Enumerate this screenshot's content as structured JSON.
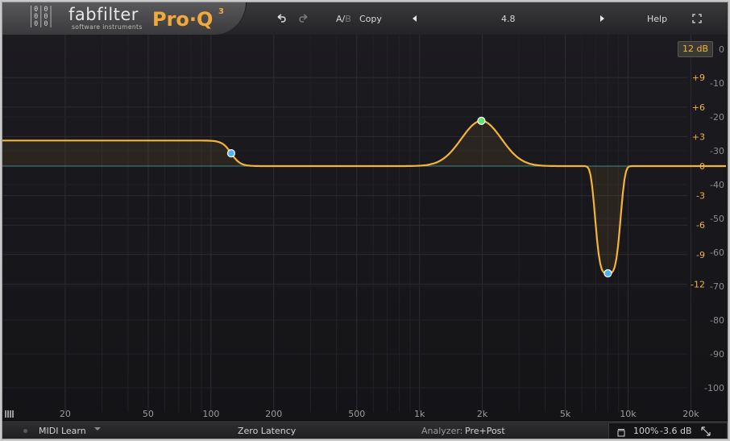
{
  "header": {
    "logo_mark": "|0|0|\n|0|0|\n|0|0|",
    "brand": "fabfilter",
    "brand_sub": "software instruments",
    "product": "Pro·Q",
    "product_sup": "3",
    "undo_icon": "undo-icon",
    "redo_icon": "redo-icon",
    "ab_label_a": "A/",
    "ab_label_b": "B",
    "copy_label": "Copy",
    "preset_value": "4.8",
    "help_label": "Help",
    "fullscreen_icon": "fullscreen-icon"
  },
  "display": {
    "range_badge": "12 dB",
    "gain_ticks": [
      {
        "label": "+9",
        "db": 9
      },
      {
        "label": "+6",
        "db": 6
      },
      {
        "label": "+3",
        "db": 3
      },
      {
        "label": "0",
        "db": 0
      },
      {
        "label": "-3",
        "db": -3
      },
      {
        "label": "-6",
        "db": -6
      },
      {
        "label": "-9",
        "db": -9
      },
      {
        "label": "-12",
        "db": -12
      }
    ],
    "spectrum_ticks": [
      "0",
      "-10",
      "-20",
      "-30",
      "-40",
      "-50",
      "-60",
      "-70",
      "-80",
      "-90",
      "-100"
    ],
    "freq_ticks": [
      {
        "label": "20",
        "hz": 20
      },
      {
        "label": "50",
        "hz": 50
      },
      {
        "label": "100",
        "hz": 100
      },
      {
        "label": "200",
        "hz": 200
      },
      {
        "label": "500",
        "hz": 500
      },
      {
        "label": "1k",
        "hz": 1000
      },
      {
        "label": "2k",
        "hz": 2000
      },
      {
        "label": "5k",
        "hz": 5000
      },
      {
        "label": "10k",
        "hz": 10000
      },
      {
        "label": "20k",
        "hz": 20000
      }
    ],
    "colors": {
      "curve": "#f2b43a",
      "band_blue": "#4fb3f2",
      "band_green": "#63e06e",
      "zero_line": "#2f8a8a",
      "gain_label": "#f2b347"
    }
  },
  "chart_data": {
    "type": "line",
    "x_scale": "log",
    "xlim": [
      10,
      30000
    ],
    "ylim": [
      -12,
      12
    ],
    "bands": [
      {
        "type": "low-shelf",
        "freq_hz": 125,
        "gain_db": 2.6,
        "color": "blue"
      },
      {
        "type": "bell",
        "freq_hz": 1980,
        "gain_db": 4.6,
        "color": "green"
      },
      {
        "type": "notch",
        "freq_hz": 8000,
        "gain_db": -10.9,
        "color": "blue"
      }
    ]
  },
  "footer": {
    "midi_learn": "MIDI Learn",
    "latency": "Zero Latency",
    "analyzer_label": "Analyzer:",
    "analyzer_value": "Pre+Post",
    "zoom": "100%",
    "output_gain": "-3.6 dB"
  }
}
